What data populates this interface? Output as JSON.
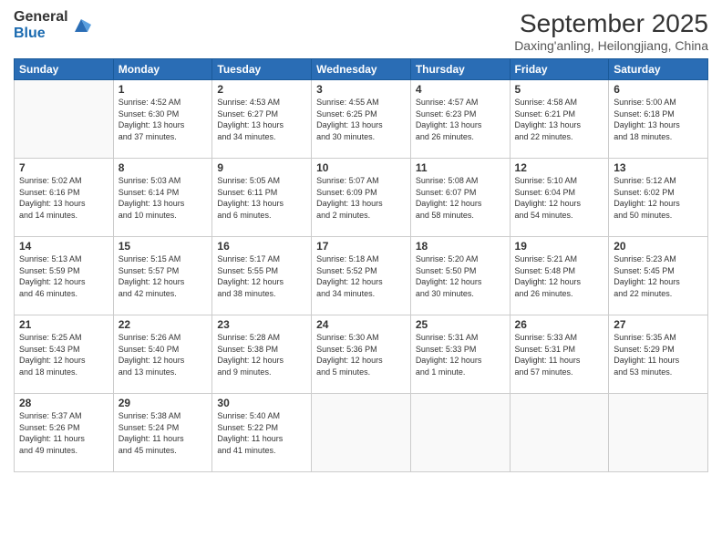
{
  "logo": {
    "general": "General",
    "blue": "Blue"
  },
  "title": "September 2025",
  "location": "Daxing'anling, Heilongjiang, China",
  "days_of_week": [
    "Sunday",
    "Monday",
    "Tuesday",
    "Wednesday",
    "Thursday",
    "Friday",
    "Saturday"
  ],
  "weeks": [
    [
      {
        "day": "",
        "info": ""
      },
      {
        "day": "1",
        "info": "Sunrise: 4:52 AM\nSunset: 6:30 PM\nDaylight: 13 hours\nand 37 minutes."
      },
      {
        "day": "2",
        "info": "Sunrise: 4:53 AM\nSunset: 6:27 PM\nDaylight: 13 hours\nand 34 minutes."
      },
      {
        "day": "3",
        "info": "Sunrise: 4:55 AM\nSunset: 6:25 PM\nDaylight: 13 hours\nand 30 minutes."
      },
      {
        "day": "4",
        "info": "Sunrise: 4:57 AM\nSunset: 6:23 PM\nDaylight: 13 hours\nand 26 minutes."
      },
      {
        "day": "5",
        "info": "Sunrise: 4:58 AM\nSunset: 6:21 PM\nDaylight: 13 hours\nand 22 minutes."
      },
      {
        "day": "6",
        "info": "Sunrise: 5:00 AM\nSunset: 6:18 PM\nDaylight: 13 hours\nand 18 minutes."
      }
    ],
    [
      {
        "day": "7",
        "info": "Sunrise: 5:02 AM\nSunset: 6:16 PM\nDaylight: 13 hours\nand 14 minutes."
      },
      {
        "day": "8",
        "info": "Sunrise: 5:03 AM\nSunset: 6:14 PM\nDaylight: 13 hours\nand 10 minutes."
      },
      {
        "day": "9",
        "info": "Sunrise: 5:05 AM\nSunset: 6:11 PM\nDaylight: 13 hours\nand 6 minutes."
      },
      {
        "day": "10",
        "info": "Sunrise: 5:07 AM\nSunset: 6:09 PM\nDaylight: 13 hours\nand 2 minutes."
      },
      {
        "day": "11",
        "info": "Sunrise: 5:08 AM\nSunset: 6:07 PM\nDaylight: 12 hours\nand 58 minutes."
      },
      {
        "day": "12",
        "info": "Sunrise: 5:10 AM\nSunset: 6:04 PM\nDaylight: 12 hours\nand 54 minutes."
      },
      {
        "day": "13",
        "info": "Sunrise: 5:12 AM\nSunset: 6:02 PM\nDaylight: 12 hours\nand 50 minutes."
      }
    ],
    [
      {
        "day": "14",
        "info": "Sunrise: 5:13 AM\nSunset: 5:59 PM\nDaylight: 12 hours\nand 46 minutes."
      },
      {
        "day": "15",
        "info": "Sunrise: 5:15 AM\nSunset: 5:57 PM\nDaylight: 12 hours\nand 42 minutes."
      },
      {
        "day": "16",
        "info": "Sunrise: 5:17 AM\nSunset: 5:55 PM\nDaylight: 12 hours\nand 38 minutes."
      },
      {
        "day": "17",
        "info": "Sunrise: 5:18 AM\nSunset: 5:52 PM\nDaylight: 12 hours\nand 34 minutes."
      },
      {
        "day": "18",
        "info": "Sunrise: 5:20 AM\nSunset: 5:50 PM\nDaylight: 12 hours\nand 30 minutes."
      },
      {
        "day": "19",
        "info": "Sunrise: 5:21 AM\nSunset: 5:48 PM\nDaylight: 12 hours\nand 26 minutes."
      },
      {
        "day": "20",
        "info": "Sunrise: 5:23 AM\nSunset: 5:45 PM\nDaylight: 12 hours\nand 22 minutes."
      }
    ],
    [
      {
        "day": "21",
        "info": "Sunrise: 5:25 AM\nSunset: 5:43 PM\nDaylight: 12 hours\nand 18 minutes."
      },
      {
        "day": "22",
        "info": "Sunrise: 5:26 AM\nSunset: 5:40 PM\nDaylight: 12 hours\nand 13 minutes."
      },
      {
        "day": "23",
        "info": "Sunrise: 5:28 AM\nSunset: 5:38 PM\nDaylight: 12 hours\nand 9 minutes."
      },
      {
        "day": "24",
        "info": "Sunrise: 5:30 AM\nSunset: 5:36 PM\nDaylight: 12 hours\nand 5 minutes."
      },
      {
        "day": "25",
        "info": "Sunrise: 5:31 AM\nSunset: 5:33 PM\nDaylight: 12 hours\nand 1 minute."
      },
      {
        "day": "26",
        "info": "Sunrise: 5:33 AM\nSunset: 5:31 PM\nDaylight: 11 hours\nand 57 minutes."
      },
      {
        "day": "27",
        "info": "Sunrise: 5:35 AM\nSunset: 5:29 PM\nDaylight: 11 hours\nand 53 minutes."
      }
    ],
    [
      {
        "day": "28",
        "info": "Sunrise: 5:37 AM\nSunset: 5:26 PM\nDaylight: 11 hours\nand 49 minutes."
      },
      {
        "day": "29",
        "info": "Sunrise: 5:38 AM\nSunset: 5:24 PM\nDaylight: 11 hours\nand 45 minutes."
      },
      {
        "day": "30",
        "info": "Sunrise: 5:40 AM\nSunset: 5:22 PM\nDaylight: 11 hours\nand 41 minutes."
      },
      {
        "day": "",
        "info": ""
      },
      {
        "day": "",
        "info": ""
      },
      {
        "day": "",
        "info": ""
      },
      {
        "day": "",
        "info": ""
      }
    ]
  ]
}
